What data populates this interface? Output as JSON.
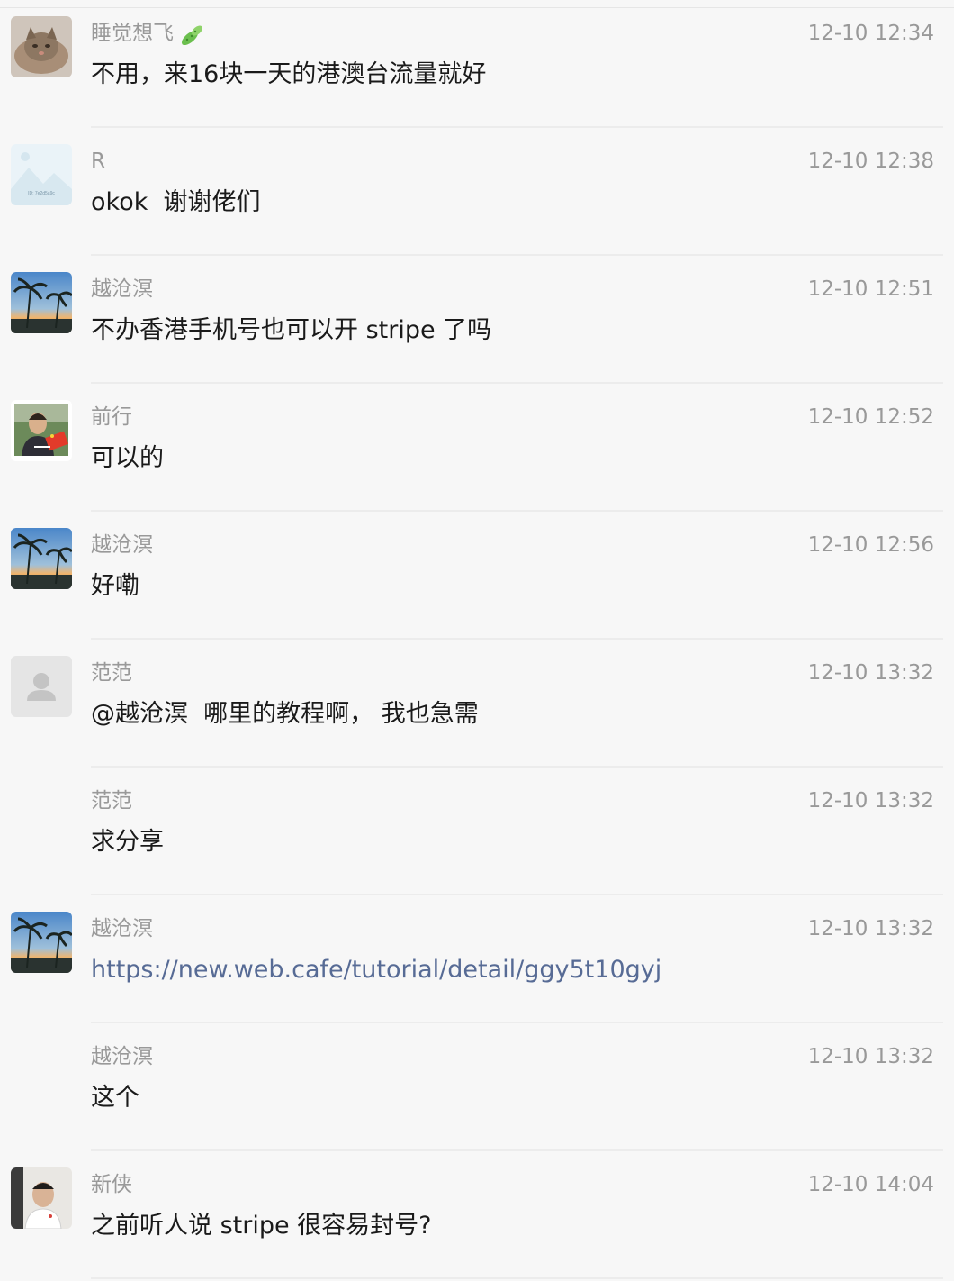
{
  "messages": [
    {
      "sender": "睡觉想飞",
      "time": "12-10 12:34",
      "text": "不用，来16块一天的港澳台流量就好",
      "avatar": "cat-avatar",
      "badge": "cucumber-icon"
    },
    {
      "sender": "R",
      "time": "12-10 12:38",
      "text": "okok  谢谢佬们",
      "avatar": "landscape-avatar",
      "avatar_caption": "ID: 7e2d5a9c"
    },
    {
      "sender": "越沧溟",
      "time": "12-10 12:51",
      "text": "不办香港手机号也可以开 stripe 了吗",
      "avatar": "palm-tree-avatar"
    },
    {
      "sender": "前行",
      "time": "12-10 12:52",
      "text": "可以的",
      "avatar": "person-flag-avatar"
    },
    {
      "sender": "越沧溟",
      "time": "12-10 12:56",
      "text": "好嘞",
      "avatar": "palm-tree-avatar"
    },
    {
      "sender": "范范",
      "time": "12-10 13:32",
      "text": "@越沧溟  哪里的教程啊， 我也急需",
      "avatar": "default-user-avatar"
    },
    {
      "sender": "范范",
      "time": "12-10 13:32",
      "text": "求分享",
      "avatar": ""
    },
    {
      "sender": "越沧溟",
      "time": "12-10 13:32",
      "text": "https://new.web.cafe/tutorial/detail/ggy5t10gyj",
      "avatar": "palm-tree-avatar",
      "is_link": true
    },
    {
      "sender": "越沧溟",
      "time": "12-10 13:32",
      "text": "这个",
      "avatar": ""
    },
    {
      "sender": "新侠",
      "time": "12-10 14:04",
      "text": "之前听人说 stripe 很容易封号?",
      "avatar": "person-avatar"
    }
  ],
  "colors": {
    "background": "#f7f7f7",
    "meta_text": "#999999",
    "body_text": "#1a1a1a",
    "link": "#576b95",
    "divider": "#ececec"
  }
}
